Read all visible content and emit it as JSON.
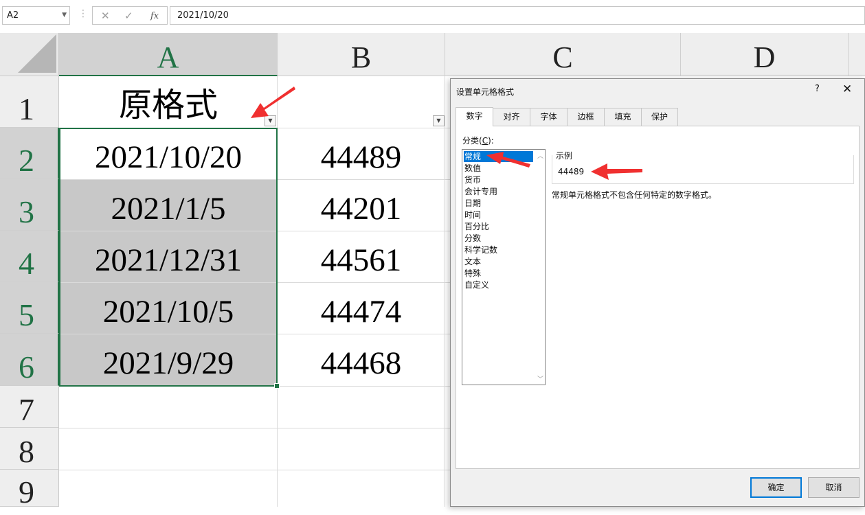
{
  "formula_bar": {
    "name_box": "A2",
    "cancel_icon": "✕",
    "enter_icon": "✓",
    "fx_icon": "fx",
    "value": "2021/10/20"
  },
  "sheet": {
    "columns": [
      "A",
      "B",
      "C",
      "D"
    ],
    "selected_column": "A",
    "rows": [
      "1",
      "2",
      "3",
      "4",
      "5",
      "6",
      "7",
      "8",
      "9"
    ],
    "header_cell": "原格式",
    "col_a": [
      "2021/10/20",
      "2021/1/5",
      "2021/12/31",
      "2021/10/5",
      "2021/9/29"
    ],
    "col_b": [
      "44489",
      "44201",
      "44561",
      "44474",
      "44468"
    ],
    "filter_icon": "▼"
  },
  "dialog": {
    "title": "设置单元格格式",
    "help": "?",
    "close": "✕",
    "tabs": [
      "数字",
      "对齐",
      "字体",
      "边框",
      "填充",
      "保护"
    ],
    "active_tab": "数字",
    "category_label_prefix": "分类(",
    "category_label_key": "C",
    "category_label_suffix": "):",
    "categories": [
      "常规",
      "数值",
      "货币",
      "会计专用",
      "日期",
      "时间",
      "百分比",
      "分数",
      "科学记数",
      "文本",
      "特殊",
      "自定义"
    ],
    "selected_category": "常规",
    "sample_label": "示例",
    "sample_value": "44489",
    "description": "常规单元格格式不包含任何特定的数字格式。",
    "ok_button": "确定",
    "cancel_button": "取消",
    "scroll_up": "︿",
    "scroll_down": "﹀"
  },
  "colors": {
    "selection_green": "#217346",
    "selected_fill": "#c8c8c8",
    "list_highlight": "#0078d7",
    "arrow_red": "#f03030"
  }
}
